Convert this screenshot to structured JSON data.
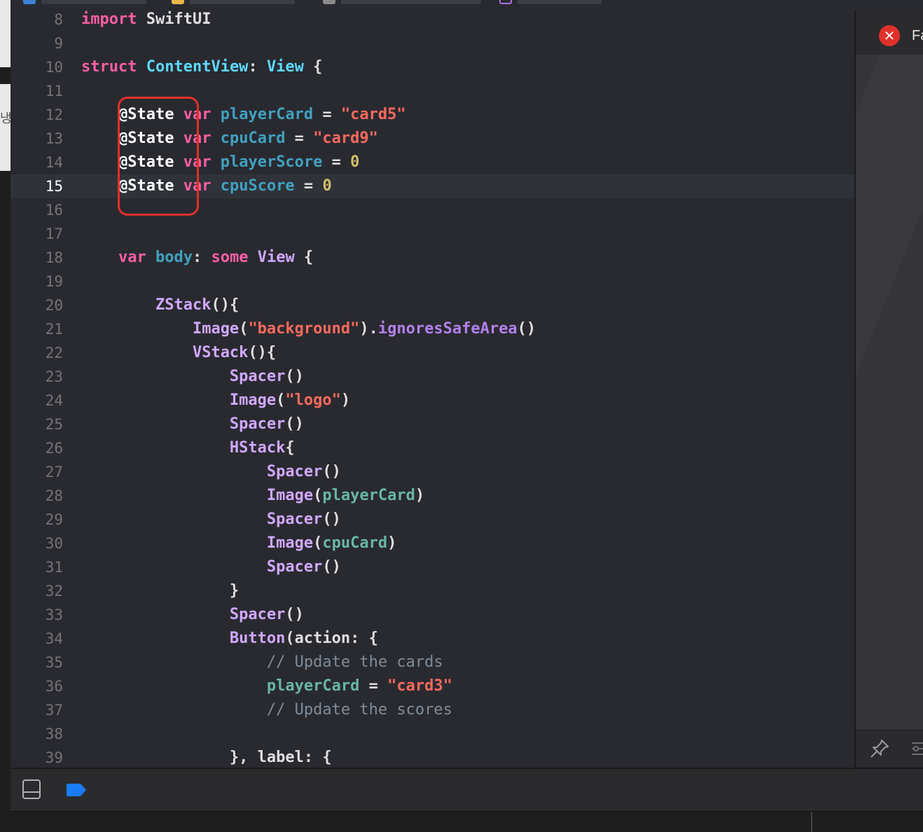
{
  "window": {
    "side_glyph": "냉"
  },
  "editor": {
    "current_line": "15",
    "lines": [
      {
        "num": "8",
        "tokens": [
          {
            "t": "import",
            "c": "k"
          },
          {
            "t": " SwiftUI",
            "c": "pl"
          }
        ]
      },
      {
        "num": "9",
        "tokens": []
      },
      {
        "num": "10",
        "tokens": [
          {
            "t": "struct",
            "c": "k"
          },
          {
            "t": " ",
            "c": "pl"
          },
          {
            "t": "ContentView",
            "c": "tp"
          },
          {
            "t": ": ",
            "c": "pl"
          },
          {
            "t": "View",
            "c": "tp"
          },
          {
            "t": " {",
            "c": "pl"
          }
        ]
      },
      {
        "num": "11",
        "tokens": []
      },
      {
        "num": "12",
        "tokens": [
          {
            "t": "    ",
            "c": "pl"
          },
          {
            "t": "@State",
            "c": "att"
          },
          {
            "t": " ",
            "c": "pl"
          },
          {
            "t": "var",
            "c": "k"
          },
          {
            "t": " ",
            "c": "pl"
          },
          {
            "t": "playerCard",
            "c": "prop"
          },
          {
            "t": " = ",
            "c": "pl"
          },
          {
            "t": "\"card5\"",
            "c": "str"
          }
        ]
      },
      {
        "num": "13",
        "tokens": [
          {
            "t": "    ",
            "c": "pl"
          },
          {
            "t": "@State",
            "c": "att"
          },
          {
            "t": " ",
            "c": "pl"
          },
          {
            "t": "var",
            "c": "k"
          },
          {
            "t": " ",
            "c": "pl"
          },
          {
            "t": "cpuCard",
            "c": "prop"
          },
          {
            "t": " = ",
            "c": "pl"
          },
          {
            "t": "\"card9\"",
            "c": "str"
          }
        ]
      },
      {
        "num": "14",
        "tokens": [
          {
            "t": "    ",
            "c": "pl"
          },
          {
            "t": "@State",
            "c": "att"
          },
          {
            "t": " ",
            "c": "pl"
          },
          {
            "t": "var",
            "c": "k"
          },
          {
            "t": " ",
            "c": "pl"
          },
          {
            "t": "playerScore",
            "c": "prop"
          },
          {
            "t": " = ",
            "c": "pl"
          },
          {
            "t": "0",
            "c": "num"
          }
        ]
      },
      {
        "num": "15",
        "tokens": [
          {
            "t": "    ",
            "c": "pl"
          },
          {
            "t": "@State",
            "c": "att"
          },
          {
            "t": " ",
            "c": "pl"
          },
          {
            "t": "var",
            "c": "k"
          },
          {
            "t": " ",
            "c": "pl"
          },
          {
            "t": "cpuScore",
            "c": "prop"
          },
          {
            "t": " = ",
            "c": "pl"
          },
          {
            "t": "0",
            "c": "num"
          }
        ]
      },
      {
        "num": "16",
        "tokens": []
      },
      {
        "num": "17",
        "tokens": []
      },
      {
        "num": "18",
        "tokens": [
          {
            "t": "    ",
            "c": "pl"
          },
          {
            "t": "var",
            "c": "k"
          },
          {
            "t": " ",
            "c": "pl"
          },
          {
            "t": "body",
            "c": "prop"
          },
          {
            "t": ": ",
            "c": "pl"
          },
          {
            "t": "some",
            "c": "k"
          },
          {
            "t": " ",
            "c": "pl"
          },
          {
            "t": "View",
            "c": "fn"
          },
          {
            "t": " {",
            "c": "pl"
          }
        ]
      },
      {
        "num": "19",
        "tokens": []
      },
      {
        "num": "20",
        "tokens": [
          {
            "t": "        ",
            "c": "pl"
          },
          {
            "t": "ZStack",
            "c": "fn"
          },
          {
            "t": "(){",
            "c": "pl"
          }
        ]
      },
      {
        "num": "21",
        "tokens": [
          {
            "t": "            ",
            "c": "pl"
          },
          {
            "t": "Image",
            "c": "fn"
          },
          {
            "t": "(",
            "c": "pl"
          },
          {
            "t": "\"background\"",
            "c": "str"
          },
          {
            "t": ").",
            "c": "pl"
          },
          {
            "t": "ignoresSafeArea",
            "c": "meth"
          },
          {
            "t": "()",
            "c": "pl"
          }
        ]
      },
      {
        "num": "22",
        "tokens": [
          {
            "t": "            ",
            "c": "pl"
          },
          {
            "t": "VStack",
            "c": "fn"
          },
          {
            "t": "(){",
            "c": "pl"
          }
        ]
      },
      {
        "num": "23",
        "tokens": [
          {
            "t": "                ",
            "c": "pl"
          },
          {
            "t": "Spacer",
            "c": "fn"
          },
          {
            "t": "()",
            "c": "pl"
          }
        ]
      },
      {
        "num": "24",
        "tokens": [
          {
            "t": "                ",
            "c": "pl"
          },
          {
            "t": "Image",
            "c": "fn"
          },
          {
            "t": "(",
            "c": "pl"
          },
          {
            "t": "\"logo\"",
            "c": "str"
          },
          {
            "t": ")",
            "c": "pl"
          }
        ]
      },
      {
        "num": "25",
        "tokens": [
          {
            "t": "                ",
            "c": "pl"
          },
          {
            "t": "Spacer",
            "c": "fn"
          },
          {
            "t": "()",
            "c": "pl"
          }
        ]
      },
      {
        "num": "26",
        "tokens": [
          {
            "t": "                ",
            "c": "pl"
          },
          {
            "t": "HStack",
            "c": "fn"
          },
          {
            "t": "{",
            "c": "pl"
          }
        ]
      },
      {
        "num": "27",
        "tokens": [
          {
            "t": "                    ",
            "c": "pl"
          },
          {
            "t": "Spacer",
            "c": "fn"
          },
          {
            "t": "()",
            "c": "pl"
          }
        ]
      },
      {
        "num": "28",
        "tokens": [
          {
            "t": "                    ",
            "c": "pl"
          },
          {
            "t": "Image",
            "c": "fn"
          },
          {
            "t": "(",
            "c": "pl"
          },
          {
            "t": "playerCard",
            "c": "ref"
          },
          {
            "t": ")",
            "c": "pl"
          }
        ]
      },
      {
        "num": "29",
        "tokens": [
          {
            "t": "                    ",
            "c": "pl"
          },
          {
            "t": "Spacer",
            "c": "fn"
          },
          {
            "t": "()",
            "c": "pl"
          }
        ]
      },
      {
        "num": "30",
        "tokens": [
          {
            "t": "                    ",
            "c": "pl"
          },
          {
            "t": "Image",
            "c": "fn"
          },
          {
            "t": "(",
            "c": "pl"
          },
          {
            "t": "cpuCard",
            "c": "ref"
          },
          {
            "t": ")",
            "c": "pl"
          }
        ]
      },
      {
        "num": "31",
        "tokens": [
          {
            "t": "                    ",
            "c": "pl"
          },
          {
            "t": "Spacer",
            "c": "fn"
          },
          {
            "t": "()",
            "c": "pl"
          }
        ]
      },
      {
        "num": "32",
        "tokens": [
          {
            "t": "                ",
            "c": "pl"
          },
          {
            "t": "}",
            "c": "pl"
          }
        ]
      },
      {
        "num": "33",
        "tokens": [
          {
            "t": "                ",
            "c": "pl"
          },
          {
            "t": "Spacer",
            "c": "fn"
          },
          {
            "t": "()",
            "c": "pl"
          }
        ]
      },
      {
        "num": "34",
        "tokens": [
          {
            "t": "                ",
            "c": "pl"
          },
          {
            "t": "Button",
            "c": "fn"
          },
          {
            "t": "(action: {",
            "c": "pl"
          }
        ]
      },
      {
        "num": "35",
        "tokens": [
          {
            "t": "                    ",
            "c": "pl"
          },
          {
            "t": "// Update the cards",
            "c": "cm"
          }
        ]
      },
      {
        "num": "36",
        "tokens": [
          {
            "t": "                    ",
            "c": "pl"
          },
          {
            "t": "playerCard",
            "c": "ref"
          },
          {
            "t": " = ",
            "c": "pl"
          },
          {
            "t": "\"card3\"",
            "c": "str"
          }
        ]
      },
      {
        "num": "37",
        "tokens": [
          {
            "t": "                    ",
            "c": "pl"
          },
          {
            "t": "// Update the scores",
            "c": "cm"
          }
        ]
      },
      {
        "num": "38",
        "tokens": []
      },
      {
        "num": "39",
        "tokens": [
          {
            "t": "                ",
            "c": "pl"
          },
          {
            "t": "}, label: {",
            "c": "pl"
          }
        ]
      }
    ]
  },
  "side_panel": {
    "error_text": "Fa",
    "error_icon": "error-x-icon"
  },
  "bottom_bar": {
    "icons": [
      "hide-debug-area-icon",
      "breakpoint-toggle-icon"
    ],
    "accent_color": "#1a7cf5"
  },
  "colors": {
    "background": "#292a30",
    "keyword": "#fc5fa3",
    "type": "#5dd8ff",
    "string": "#fc6a5d",
    "number": "#d0bf69",
    "function": "#d0a8ff",
    "comment": "#7f8c98",
    "annotation_box": "#e0302b"
  }
}
